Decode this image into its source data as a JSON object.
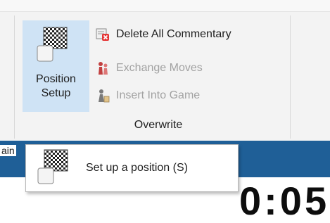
{
  "ribbon": {
    "position_setup": {
      "line1": "Position",
      "line2": "Setup",
      "icon": "chessboard-icon"
    },
    "commands": [
      {
        "label": "Delete All Commentary",
        "icon": "delete-commentary-icon",
        "enabled": true
      },
      {
        "label": "Exchange Moves",
        "icon": "exchange-moves-icon",
        "enabled": false
      },
      {
        "label": "Insert Into Game",
        "icon": "insert-into-game-icon",
        "enabled": false
      }
    ],
    "group_title": "Overwrite"
  },
  "statusbar": {
    "partial_text": "ain",
    "color": "#1f5f97"
  },
  "tooltip": {
    "text": "Set up a position (S)",
    "icon": "chessboard-icon"
  },
  "background_digits": "0:05",
  "colors": {
    "selected_button_bg": "#cfe3f5",
    "disabled_text": "#a2a2a2",
    "statusbar_bg": "#1f5f97"
  }
}
